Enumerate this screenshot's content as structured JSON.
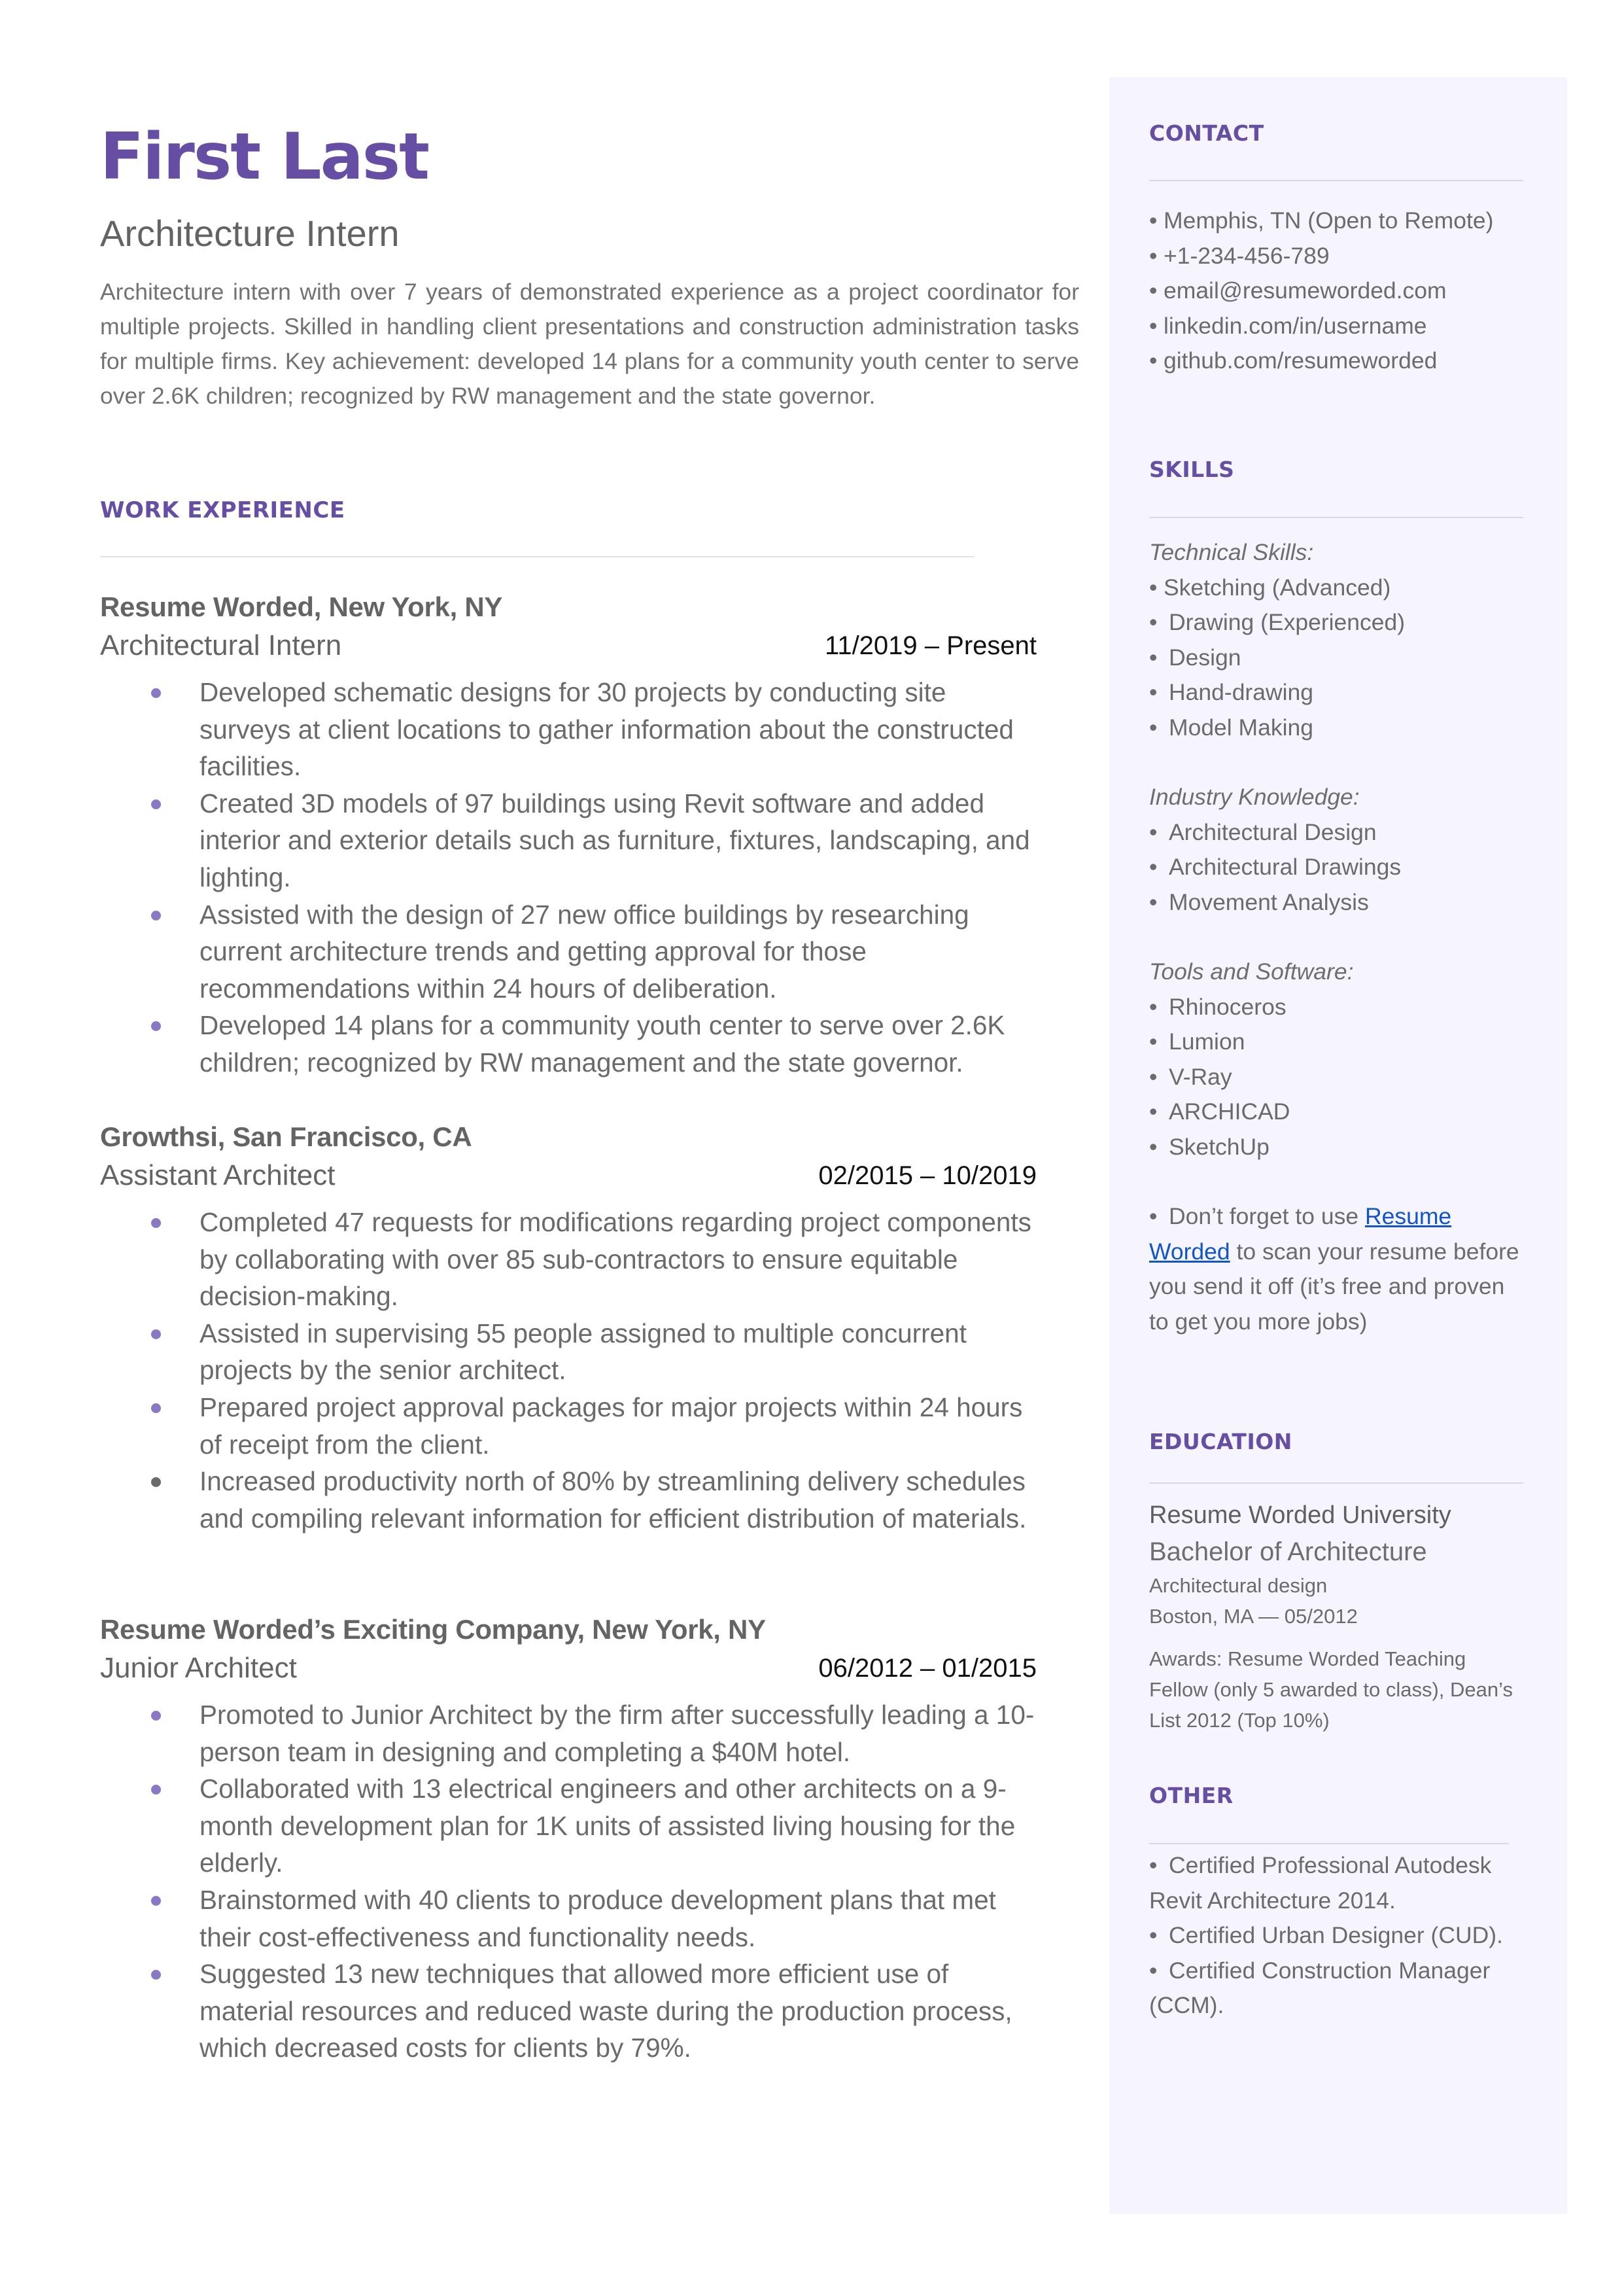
{
  "header": {
    "name": "First Last",
    "role": "Architecture Intern",
    "summary": "Architecture intern with over 7 years of demonstrated experience as a project coordinator for multiple projects. Skilled in handling client presentations and construction administration tasks for multiple firms. Key achievement: developed 14 plans for a community youth center to serve over 2.6K children; recognized by RW management and the state governor."
  },
  "work": {
    "title": "WORK EXPERIENCE",
    "jobs": [
      {
        "company": "Resume Worded, New York, NY",
        "title": "Architectural Intern",
        "dates": "11/2019 – Present",
        "bullets": [
          "Developed schematic designs for 30 projects by conducting site surveys at client locations to gather information about the constructed facilities.",
          "Created 3D models of 97 buildings using Revit software and added interior and exterior details such as furniture, fixtures, landscaping, and lighting.",
          "Assisted with the design of 27 new office buildings by researching current architecture trends and getting approval for those recommendations within 24 hours of deliberation.",
          "Developed 14 plans for a community youth center to serve over 2.6K children; recognized by RW management and the state governor."
        ]
      },
      {
        "company": "Growthsi, San Francisco, CA",
        "title": "Assistant Architect",
        "dates": "02/2015 – 10/2019",
        "bullets": [
          "Completed 47 requests for modifications regarding project components by collaborating with over 85 sub-contractors to ensure equitable decision-making.",
          "Assisted in supervising 55 people assigned to multiple concurrent projects by the senior architect.",
          "Prepared project approval packages for major projects within 24 hours of receipt from the client.",
          "Increased productivity north of 80% by streamlining delivery schedules and compiling relevant information for efficient distribution of materials."
        ]
      },
      {
        "company": "Resume Worded’s Exciting Company, New York, NY",
        "title": "Junior Architect",
        "dates": "06/2012 – 01/2015",
        "bullets": [
          "Promoted to Junior Architect by the firm after successfully leading a 10-person team in designing and completing a $40M hotel.",
          "Collaborated with 13 electrical engineers and other architects on a 9-month development plan for 1K units of assisted living housing for the elderly.",
          "Brainstormed with 40 clients to produce development plans that met their cost-effectiveness and functionality needs.",
          "Suggested 13 new techniques that allowed more efficient use of material resources and reduced waste during the production process, which decreased costs for clients by 79%."
        ]
      }
    ]
  },
  "sidebar": {
    "contact": {
      "title": "CONTACT",
      "items": [
        "Memphis, TN (Open to Remote)",
        "+1-234-456-789",
        "email@resumeworded.com",
        "linkedin.com/in/username",
        "github.com/resumeworded"
      ]
    },
    "skills": {
      "title": "SKILLS",
      "technical_label": "Technical Skills:",
      "technical": [
        "Sketching (Advanced)",
        "Drawing (Experienced)",
        "Design",
        "Hand-drawing",
        "Model Making"
      ],
      "industry_label": "Industry Knowledge:",
      "industry": [
        "Architectural Design",
        "Architectural Drawings",
        "Movement Analysis"
      ],
      "tools_label": "Tools and Software:",
      "tools": [
        "Rhinoceros",
        "Lumion",
        "V-Ray",
        "ARCHICAD",
        "SketchUp"
      ],
      "note_prefix": "Don’t forget to use ",
      "note_link": "Resume Worded",
      "note_suffix": " to scan your resume before you send it off (it’s free and proven to get you more jobs)"
    },
    "education": {
      "title": "EDUCATION",
      "school": "Resume Worded University",
      "degree": "Bachelor of Architecture",
      "field": "Architectural design",
      "location_date": "Boston, MA — 05/2012",
      "awards": "Awards: Resume Worded Teaching Fellow (only 5 awarded to class), Dean’s List 2012 (Top 10%)"
    },
    "other": {
      "title": "OTHER",
      "items": [
        "Certified Professional Autodesk Revit Architecture 2014.",
        "Certified Urban Designer (CUD).",
        "Certified Construction Manager (CCM)."
      ]
    }
  },
  "colors": {
    "accent": "#654ea3",
    "bullet": "#8a78c4",
    "sidebar_bg": "#f6f4fe",
    "link": "#1155cc"
  },
  "bullet_char": "•"
}
